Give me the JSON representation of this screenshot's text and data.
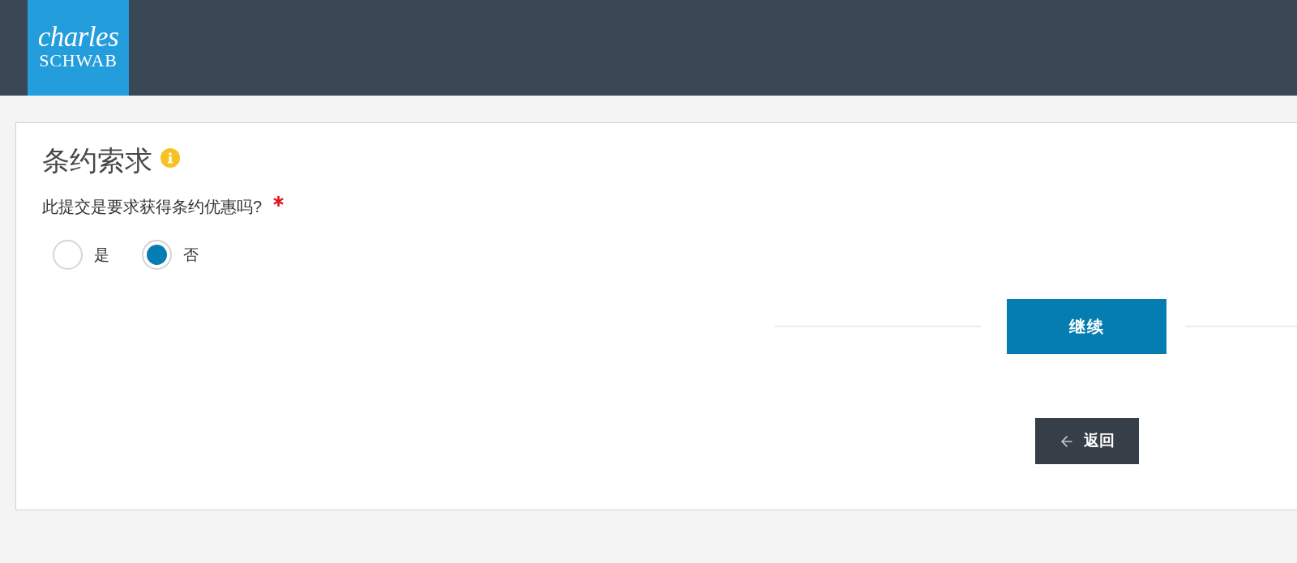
{
  "header": {
    "logo": {
      "line_1": "charles",
      "line_2": "SCHWAB"
    }
  },
  "form": {
    "title": "条约索求",
    "question": {
      "label": "此提交是要求获得条约优惠吗?",
      "required": true,
      "options": [
        {
          "label": "是",
          "selected": false
        },
        {
          "label": "否",
          "selected": true
        }
      ]
    },
    "buttons": [
      {
        "kind": "primary",
        "label": "继续"
      },
      {
        "kind": "back",
        "label": "返回"
      }
    ]
  }
}
